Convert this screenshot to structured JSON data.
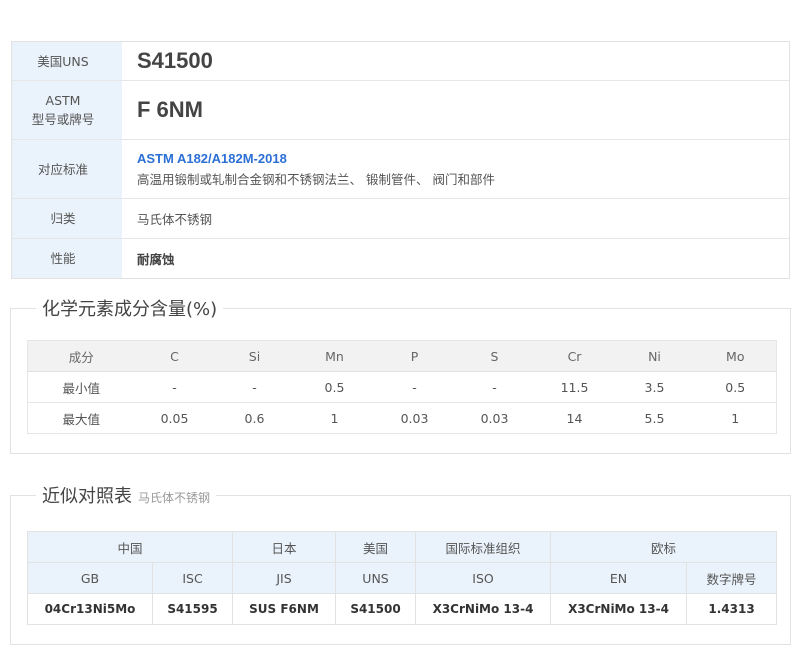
{
  "info": {
    "rows": [
      {
        "label": [
          "美国UNS"
        ],
        "value": "S41500"
      },
      {
        "label": [
          "ASTM",
          "型号或牌号"
        ],
        "value": "F 6NM"
      },
      {
        "label": [
          "对应标准"
        ],
        "link": "ASTM A182/A182M-2018",
        "desc": "高温用锻制或轧制合金钢和不锈钢法兰、 锻制管件、 阀门和部件"
      },
      {
        "label": [
          "归类"
        ],
        "value": "马氏体不锈钢"
      },
      {
        "label": [
          "性能"
        ],
        "value": "耐腐蚀"
      }
    ]
  },
  "chemical": {
    "title": "化学元素成分含量(%)",
    "headers": [
      "成分",
      "C",
      "Si",
      "Mn",
      "P",
      "S",
      "Cr",
      "Ni",
      "Mo"
    ],
    "rows": [
      [
        "最小值",
        "-",
        "-",
        "0.5",
        "-",
        "-",
        "11.5",
        "3.5",
        "0.5"
      ],
      [
        "最大值",
        "0.05",
        "0.6",
        "1",
        "0.03",
        "0.03",
        "14",
        "5.5",
        "1"
      ]
    ]
  },
  "comparison": {
    "title": "近似对照表",
    "subtitle": "马氏体不锈钢",
    "groups": [
      "中国",
      "日本",
      "美国",
      "国际标准组织",
      "欧标"
    ],
    "standards": [
      "GB",
      "ISC",
      "JIS",
      "UNS",
      "ISO",
      "EN",
      "数字牌号"
    ],
    "values": [
      "04Cr13Ni5Mo",
      "S41595",
      "SUS F6NM",
      "S41500",
      "X3CrNiMo 13-4",
      "X3CrNiMo 13-4",
      "1.4313"
    ]
  }
}
